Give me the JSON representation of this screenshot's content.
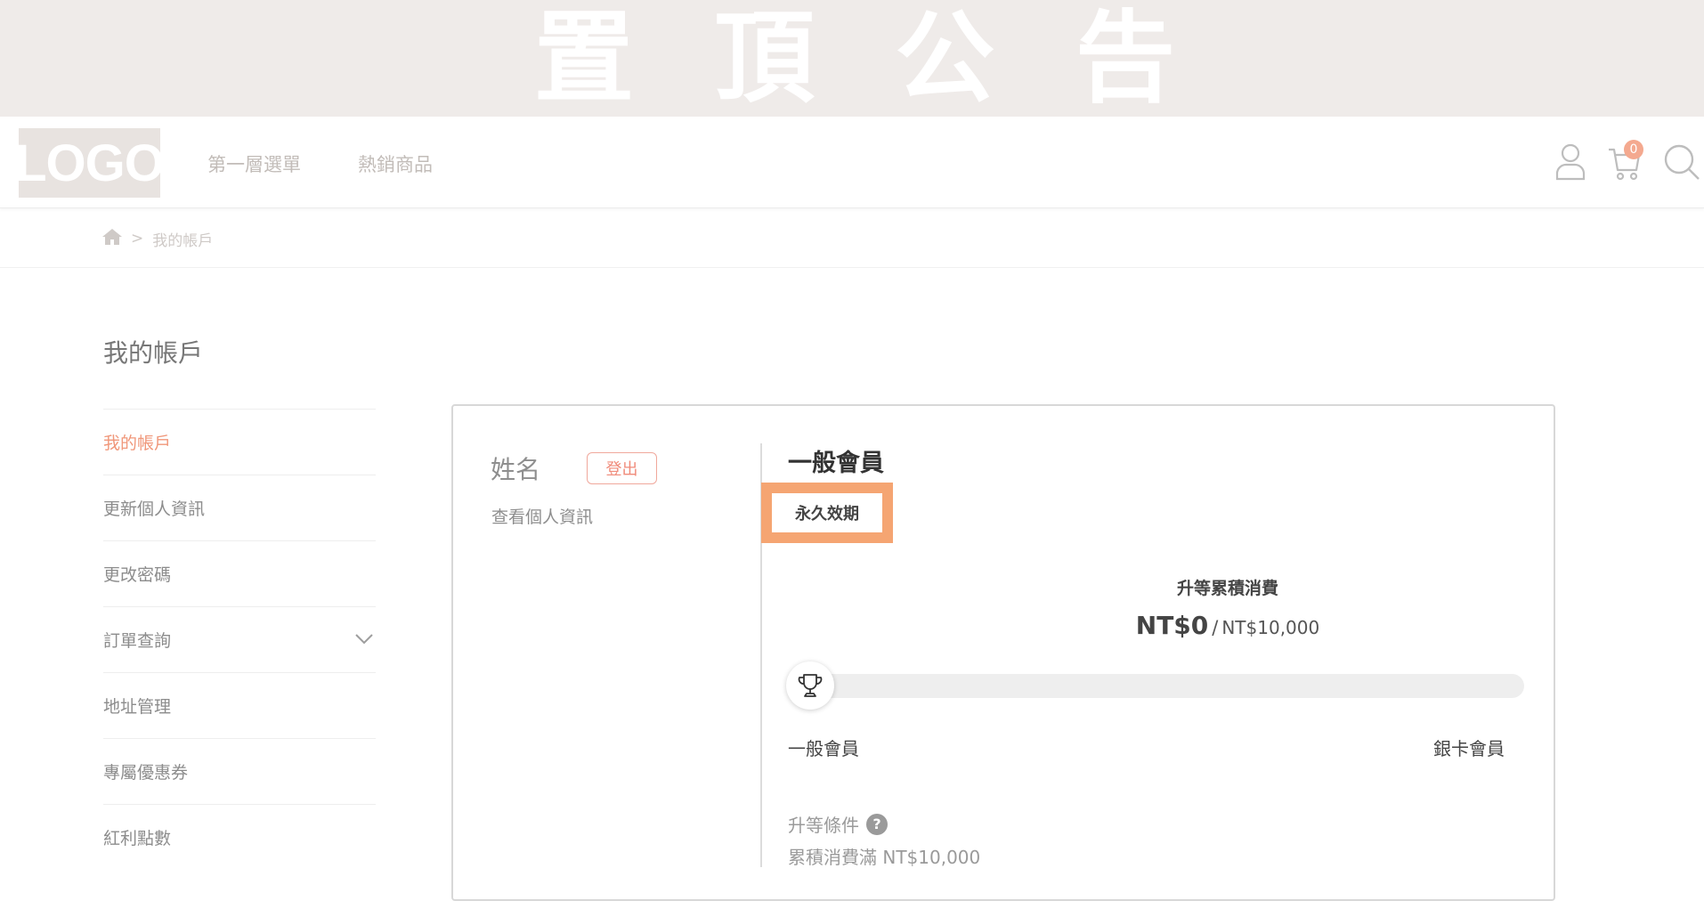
{
  "announcement": {
    "chars": [
      "置",
      "頂",
      "公",
      "告"
    ]
  },
  "header": {
    "logo": "LOGO",
    "nav": [
      "第一層選單",
      "熱銷商品"
    ],
    "cart_count": "0"
  },
  "breadcrumb": {
    "separator": ">",
    "current": "我的帳戶"
  },
  "sidebar": {
    "title": "我的帳戶",
    "items": [
      {
        "label": "我的帳戶",
        "active": true
      },
      {
        "label": "更新個人資訊"
      },
      {
        "label": "更改密碼"
      },
      {
        "label": "訂單查詢",
        "expandable": true
      },
      {
        "label": "地址管理"
      },
      {
        "label": "專屬優惠券"
      },
      {
        "label": "紅利點數"
      }
    ]
  },
  "profile": {
    "name": "姓名",
    "logout_label": "登出",
    "view_profile": "查看個人資訊"
  },
  "membership": {
    "level": "一般會員",
    "validity": "永久效期",
    "upgrade_label": "升等累積消費",
    "current_amount": "NT$0",
    "separator": "/",
    "target_amount": "NT$10,000",
    "progress_fraction": 0,
    "from_level": "一般會員",
    "to_level": "銀卡會員",
    "condition_title": "升等條件",
    "help_symbol": "?",
    "condition_desc": "累積消費滿 NT$10,000"
  },
  "colors": {
    "accent": "#f0977a",
    "highlight": "#f5a572",
    "announcement_bg": "#efebe9"
  }
}
